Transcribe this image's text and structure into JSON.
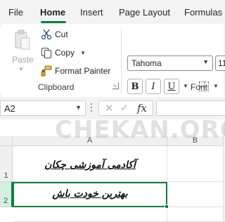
{
  "tabs": [
    {
      "label": "File"
    },
    {
      "label": "Home"
    },
    {
      "label": "Insert"
    },
    {
      "label": "Page Layout"
    },
    {
      "label": "Formulas"
    }
  ],
  "clipboard": {
    "paste_label": "Paste",
    "cut_label": "Cut",
    "copy_label": "Copy",
    "format_painter_label": "Format Painter",
    "group_label": "Clipboard"
  },
  "font": {
    "family": "Tahoma",
    "size": "11",
    "bold": "B",
    "italic": "I",
    "underline": "U",
    "group_label": "Font"
  },
  "formula_bar": {
    "name_box": "A2",
    "fx": "fx"
  },
  "sheet": {
    "columns": [
      "A",
      "B"
    ],
    "rows": [
      "1",
      "2"
    ],
    "cells": {
      "A1": "آکادمی آموزشی چکان",
      "A2": "بهترین خودت باش"
    }
  },
  "watermark": "CHEKAN.ORG",
  "colors": {
    "accent": "#107c41"
  }
}
